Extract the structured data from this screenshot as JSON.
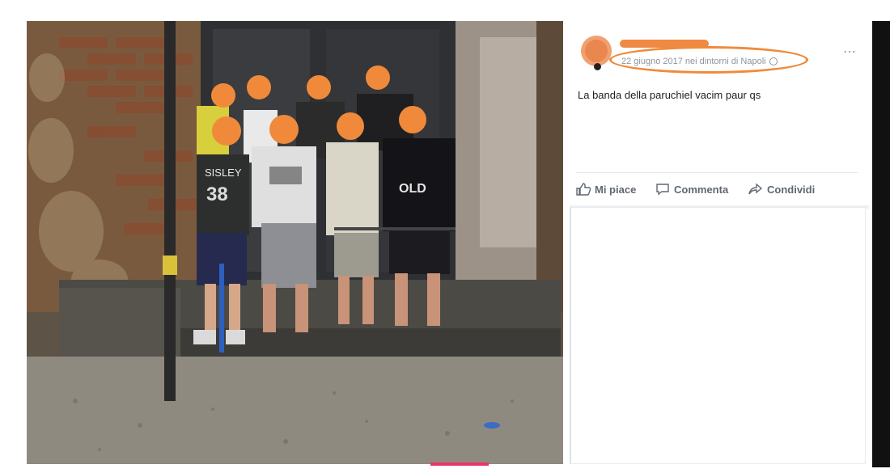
{
  "post": {
    "meta": "22 giugno 2017 nei dintorni di Napoli",
    "text": "La banda della paruchiel vacim paur qs",
    "more_icon": "⋯"
  },
  "actions": {
    "like": "Mi piace",
    "comment": "Commenta",
    "share": "Condividi"
  },
  "photo": {
    "shirt_labels": [
      "SISLEY",
      "38",
      "OLD"
    ]
  },
  "colors": {
    "annotation": "#f08a3a",
    "redaction": "#ef8a45",
    "accent_bar": "#e8356a"
  },
  "icons": [
    "avatar",
    "globe-icon",
    "more-icon",
    "like-icon",
    "comment-icon",
    "share-icon"
  ]
}
